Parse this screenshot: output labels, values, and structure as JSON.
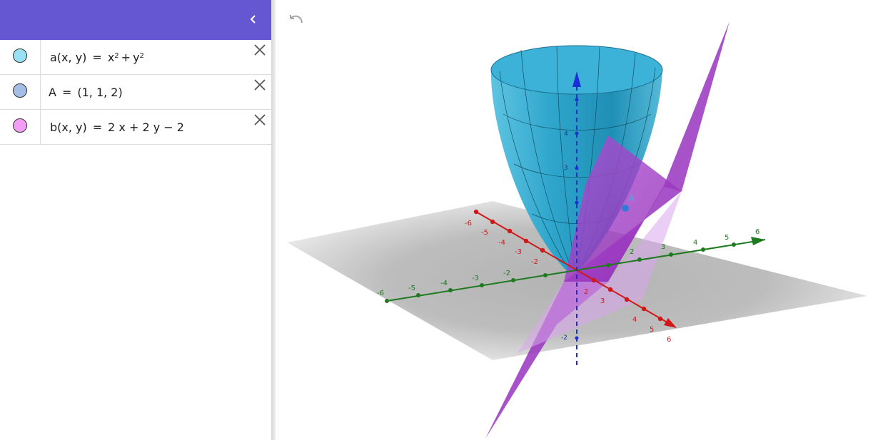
{
  "algebra": {
    "items": [
      {
        "name": "a(x, y)",
        "eq": "=",
        "rhs_x": "x",
        "exp_x": "2",
        "plus": "+",
        "rhs_y": "y",
        "exp_y": "2",
        "color": "#99e0f2"
      },
      {
        "name": "A",
        "eq": "=",
        "value": "(1, 1, 2)",
        "color": "#a4bde6"
      },
      {
        "name": "b(x, y)",
        "eq": "=",
        "value": "2 x + 2 y − 2",
        "color": "#f39ef5"
      }
    ]
  },
  "graphics": {
    "point_label": "A",
    "x_ticks": [
      "-6",
      "-5",
      "-4",
      "-3",
      "-2",
      "2",
      "3",
      "4",
      "5",
      "6"
    ],
    "y_ticks": [
      "-6",
      "-5",
      "-4",
      "-3",
      "-2",
      "2",
      "3",
      "4",
      "5",
      "6"
    ],
    "z_ticks": [
      "4",
      "3",
      "-2"
    ],
    "colors": {
      "header": "#6557d2",
      "surface": "#2fa6cc",
      "plane": "#a33bc7",
      "x_axis": "#d01818",
      "y_axis": "#1e7a1e",
      "z_axis": "#1a2fd6"
    }
  },
  "icons": {
    "collapse": "chevron-left-icon",
    "delete": "close-icon",
    "undo": "undo-icon"
  }
}
